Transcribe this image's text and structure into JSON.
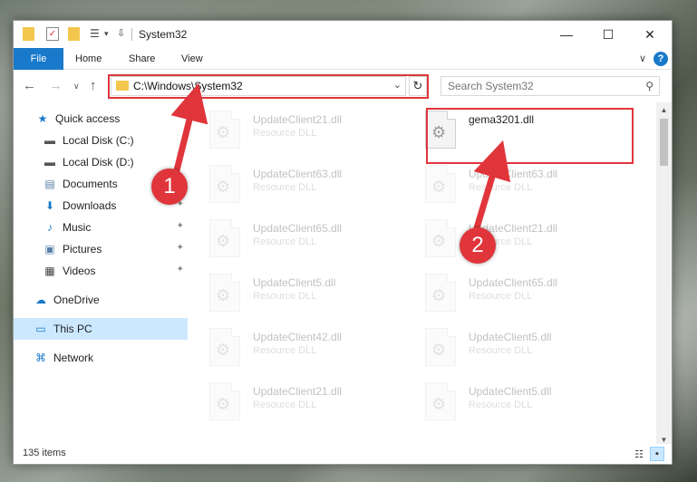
{
  "window": {
    "title": "System32"
  },
  "ribbon": {
    "tabs": [
      "File",
      "Home",
      "Share",
      "View"
    ],
    "help": "?"
  },
  "nav": {
    "address": "C:\\Windows\\System32",
    "search_placeholder": "Search System32"
  },
  "sidebar": {
    "items": [
      {
        "label": "Quick access",
        "icon": "star-icon"
      },
      {
        "label": "Local Disk (C:)",
        "icon": "drive-icon"
      },
      {
        "label": "Local Disk (D:)",
        "icon": "drive-icon"
      },
      {
        "label": "Documents",
        "icon": "documents-icon"
      },
      {
        "label": "Downloads",
        "icon": "download-icon"
      },
      {
        "label": "Music",
        "icon": "music-icon"
      },
      {
        "label": "Pictures",
        "icon": "pictures-icon"
      },
      {
        "label": "Videos",
        "icon": "videos-icon"
      },
      {
        "label": "OneDrive",
        "icon": "cloud-icon"
      },
      {
        "label": "This PC",
        "icon": "computer-icon"
      },
      {
        "label": "Network",
        "icon": "network-icon"
      }
    ]
  },
  "files": [
    {
      "name": "UpdateClient21.dll",
      "type": "Resource DLL"
    },
    {
      "name": "gema3201.dll",
      "type": ""
    },
    {
      "name": "UpdateClient63.dll",
      "type": "Resource DLL"
    },
    {
      "name": "UpdateClient63.dll",
      "type": "Resource DLL"
    },
    {
      "name": "UpdateClient65.dll",
      "type": "Resource DLL"
    },
    {
      "name": "UpdateClient21.dll",
      "type": "Resource DLL"
    },
    {
      "name": "UpdateClient5.dll",
      "type": "Resource DLL"
    },
    {
      "name": "UpdateClient65.dll",
      "type": "Resource DLL"
    },
    {
      "name": "UpdateClient42.dll",
      "type": "Resource DLL"
    },
    {
      "name": "UpdateClient5.dll",
      "type": "Resource DLL"
    },
    {
      "name": "UpdateClient21.dll",
      "type": "Resource DLL"
    },
    {
      "name": "UpdateClient5.dll",
      "type": "Resource DLL"
    }
  ],
  "status": {
    "item_count": "135 items"
  },
  "callouts": [
    "1",
    "2"
  ],
  "colors": {
    "accent": "#1979ca",
    "highlight": "#e0353b",
    "selected": "#cce8ff"
  }
}
